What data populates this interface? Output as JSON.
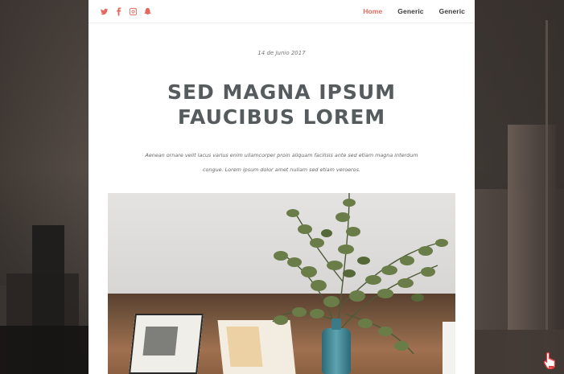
{
  "nav": {
    "social_icons": [
      "twitter-icon",
      "facebook-icon",
      "instagram-icon",
      "snapchat-icon"
    ],
    "links": [
      {
        "label": "Home",
        "active": true
      },
      {
        "label": "Generic",
        "active": false
      },
      {
        "label": "Generic",
        "active": false
      }
    ]
  },
  "post": {
    "date": "14 de Junio 2017",
    "title": "SED MAGNA IPSUM FAUCIBUS LOREM",
    "lead_line1": "Aenean ornare velit lacus varius enim ullamcorper proin aliquam facilisis ante sed etiam magna interdum",
    "lead_line2": "congue. Lorem ipsum dolor amet nullam sed etiam veroeros."
  },
  "colors": {
    "accent": "#e4685e",
    "title": "#565b5e",
    "text": "#666666"
  }
}
